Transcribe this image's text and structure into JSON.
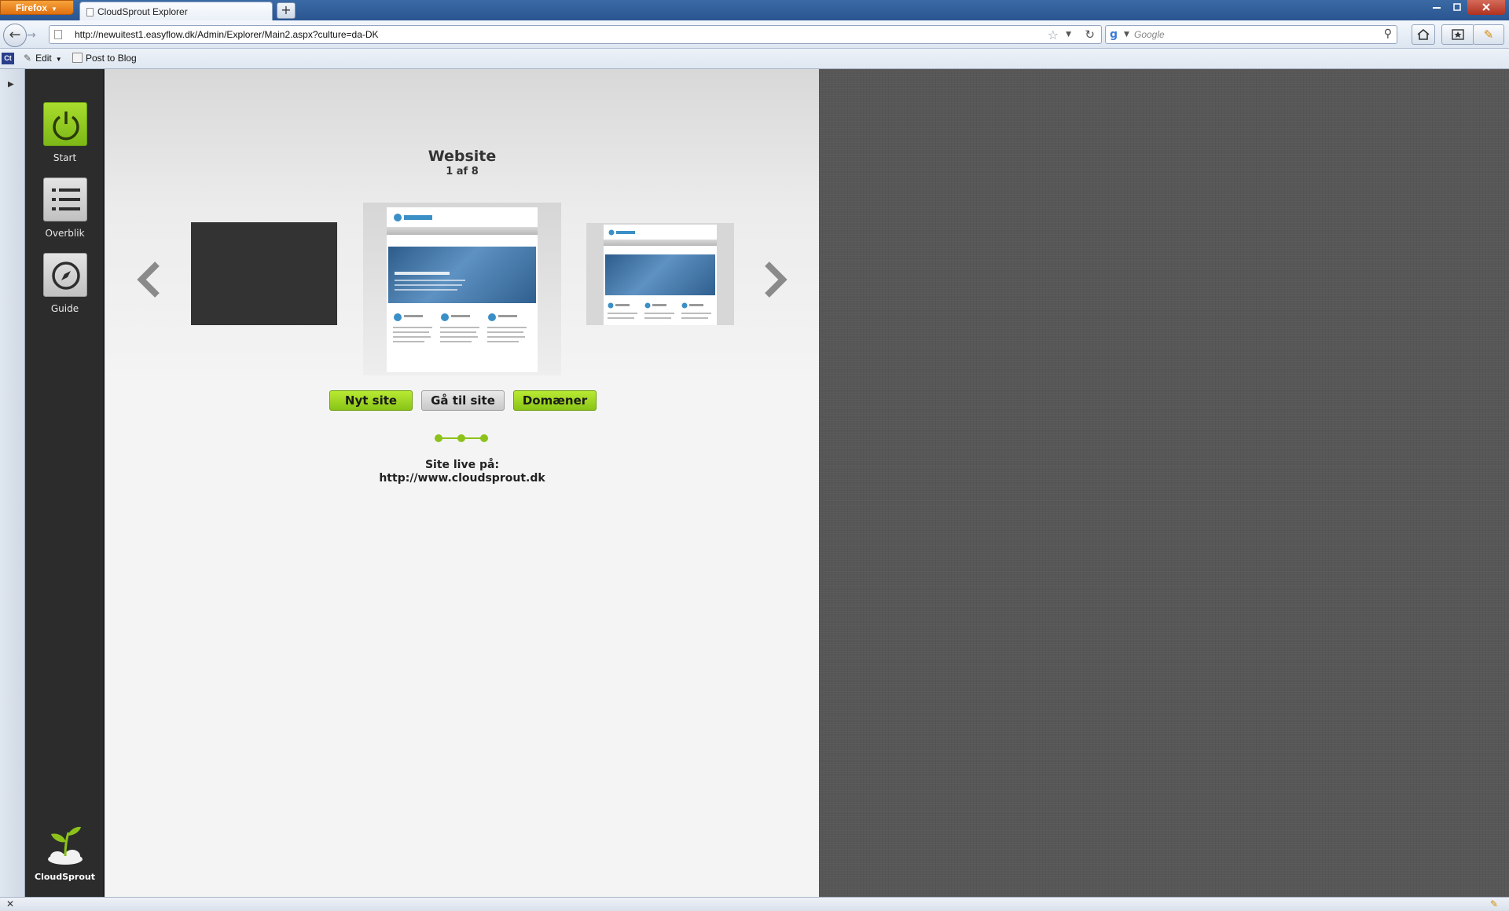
{
  "browser": {
    "menu_label": "Firefox",
    "tab_title": "CloudSprout Explorer",
    "new_tab": "+",
    "url": "http://newuitest1.easyflow.dk/Admin/Explorer/Main2.aspx?culture=da-DK",
    "search_engine": "g",
    "search_placeholder": "Google"
  },
  "bookmarks": {
    "ct_badge": "Ct",
    "edit_label": "Edit",
    "post_label": "Post to Blog"
  },
  "dock": {
    "items": [
      {
        "label": "Start",
        "icon": "power-icon"
      },
      {
        "label": "Overblik",
        "icon": "list-icon"
      },
      {
        "label": "Guide",
        "icon": "compass-icon"
      }
    ],
    "logo_label": "CloudSprout"
  },
  "website": {
    "title": "Website",
    "position": "1 af 8",
    "buttons": {
      "new_site": "Nyt site",
      "goto_site": "Gå til site",
      "domains": "Domæner"
    },
    "live_label": "Site live på:",
    "live_url": "http://www.cloudsprout.dk"
  },
  "colors": {
    "accent_green": "#8cc21a",
    "dock_bg": "#2c2c2c",
    "linen_bg": "#575757"
  }
}
